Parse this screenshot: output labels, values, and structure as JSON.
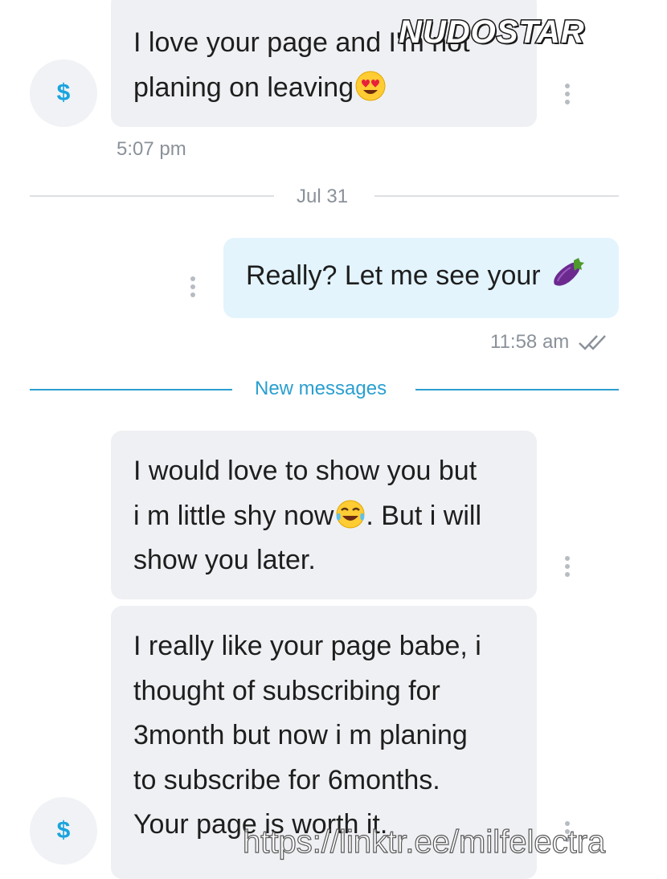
{
  "messages": {
    "m1": {
      "lines": [
        "I love your page and I'm not",
        "planing on leaving"
      ],
      "time": "5:07 pm"
    },
    "date_divider": "Jul 31",
    "m2": {
      "text": "Really? Let me see your",
      "time": "11:58 am"
    },
    "new_messages_divider": "New messages",
    "m3": {
      "lines": [
        "I would love to show you but",
        "i m little shy now",
        ". But i will",
        "show you later."
      ]
    },
    "m4": {
      "lines": [
        "I really like your page babe, i",
        "thought of subscribing for",
        "3month but now i m planing",
        "to subscribe for 6months.",
        "Your page is worth it."
      ]
    }
  },
  "avatar": {
    "symbol": "$"
  },
  "overlay": {
    "logo_text": "NUDOSTAR",
    "watermark_text": "https://linktr.ee/milfelectra"
  },
  "colors": {
    "accent": "#1aa4de",
    "incoming_bubble": "#eff0f3",
    "outgoing_bubble": "#e3f4fd",
    "divider_new": "#2a9fd0"
  },
  "icons": [
    "dollar-avatar-icon",
    "more-vert-icon",
    "double-check-icon",
    "heart-eyes-emoji",
    "eggplant-emoji",
    "tears-of-joy-emoji"
  ]
}
